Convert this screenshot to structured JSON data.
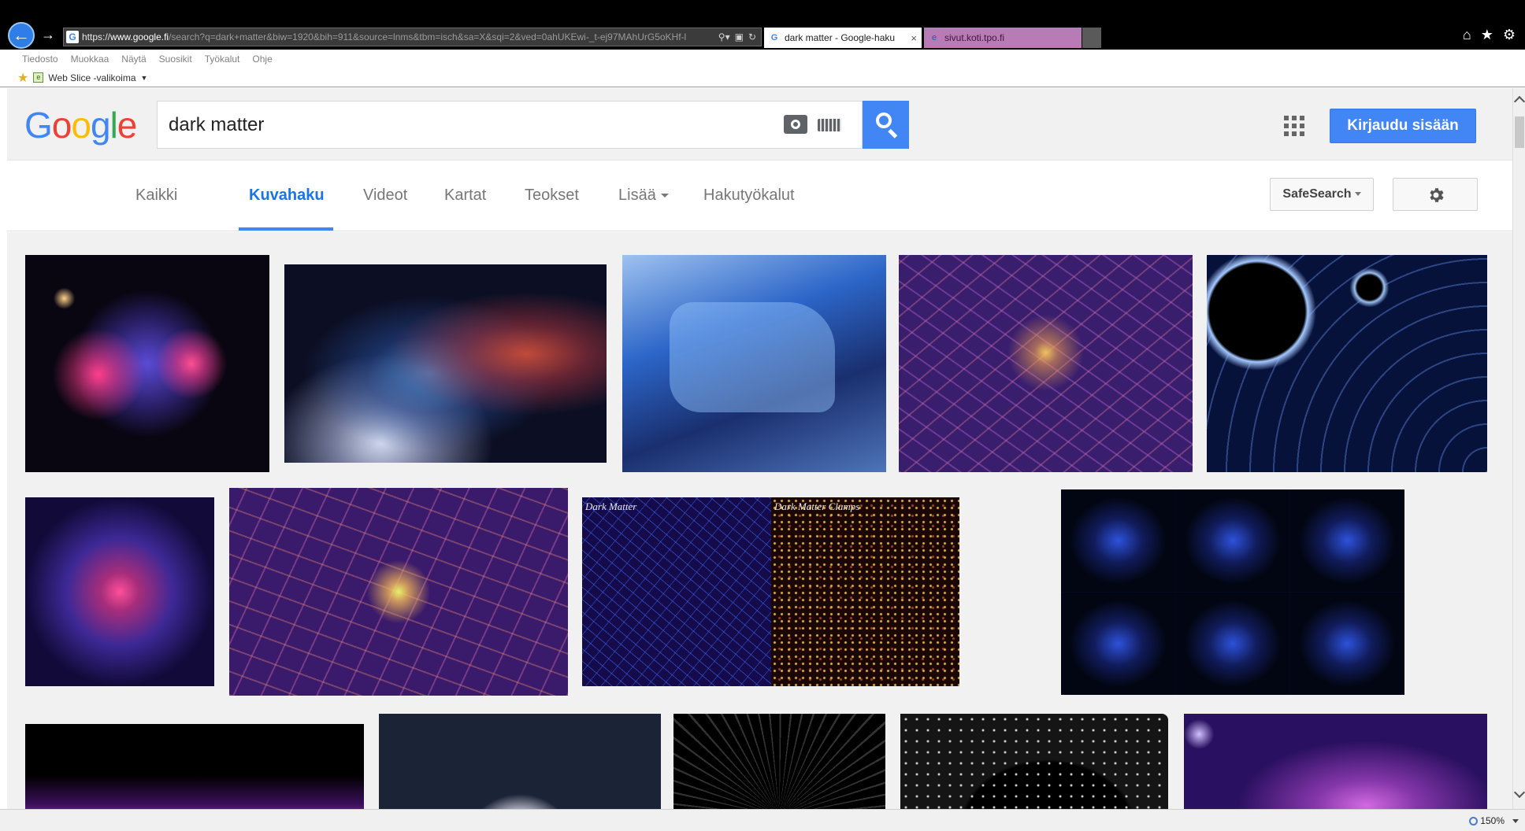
{
  "browser": {
    "address": {
      "prefix": "https://",
      "domain": "www.google.fi",
      "rest": "/search?q=dark+matter&biw=1920&bih=911&source=lnms&tbm=isch&sa=X&sqi=2&ved=0ahUKEwi-_t-ej97MAhUrG5oKHf-l"
    },
    "tabs": [
      {
        "label": "dark matter - Google-haku",
        "favicon": "google-g-icon"
      },
      {
        "label": "sivut.koti.tpo.fi",
        "favicon": "ie-icon"
      }
    ],
    "tab_close_symbol": "×",
    "menu": [
      "Tiedosto",
      "Muokkaa",
      "Näytä",
      "Suosikit",
      "Työkalut",
      "Ohje"
    ],
    "favorites_bar": {
      "web_slice_label": "Web Slice -valikoima"
    },
    "zoom": "150%"
  },
  "google": {
    "logo_letters": [
      "G",
      "o",
      "o",
      "g",
      "l",
      "e"
    ],
    "search_value": "dark matter",
    "signin_label": "Kirjaudu sisään",
    "nav": {
      "all": "Kaikki",
      "images": "Kuvahaku",
      "videos": "Videot",
      "maps": "Kartat",
      "books": "Teokset",
      "more": "Lisää",
      "tools": "Hakutyökalut"
    },
    "safesearch_label": "SafeSearch"
  },
  "results": {
    "captions": {
      "dark_matter": "Dark Matter",
      "dark_matter_clumps": "Dark Matter Clumps"
    }
  },
  "colors": {
    "google_blue": "#4285f4",
    "google_red": "#ea4335",
    "google_yellow": "#fbbc05",
    "google_green": "#34a853",
    "active_tab_text": "#1a73e8"
  }
}
